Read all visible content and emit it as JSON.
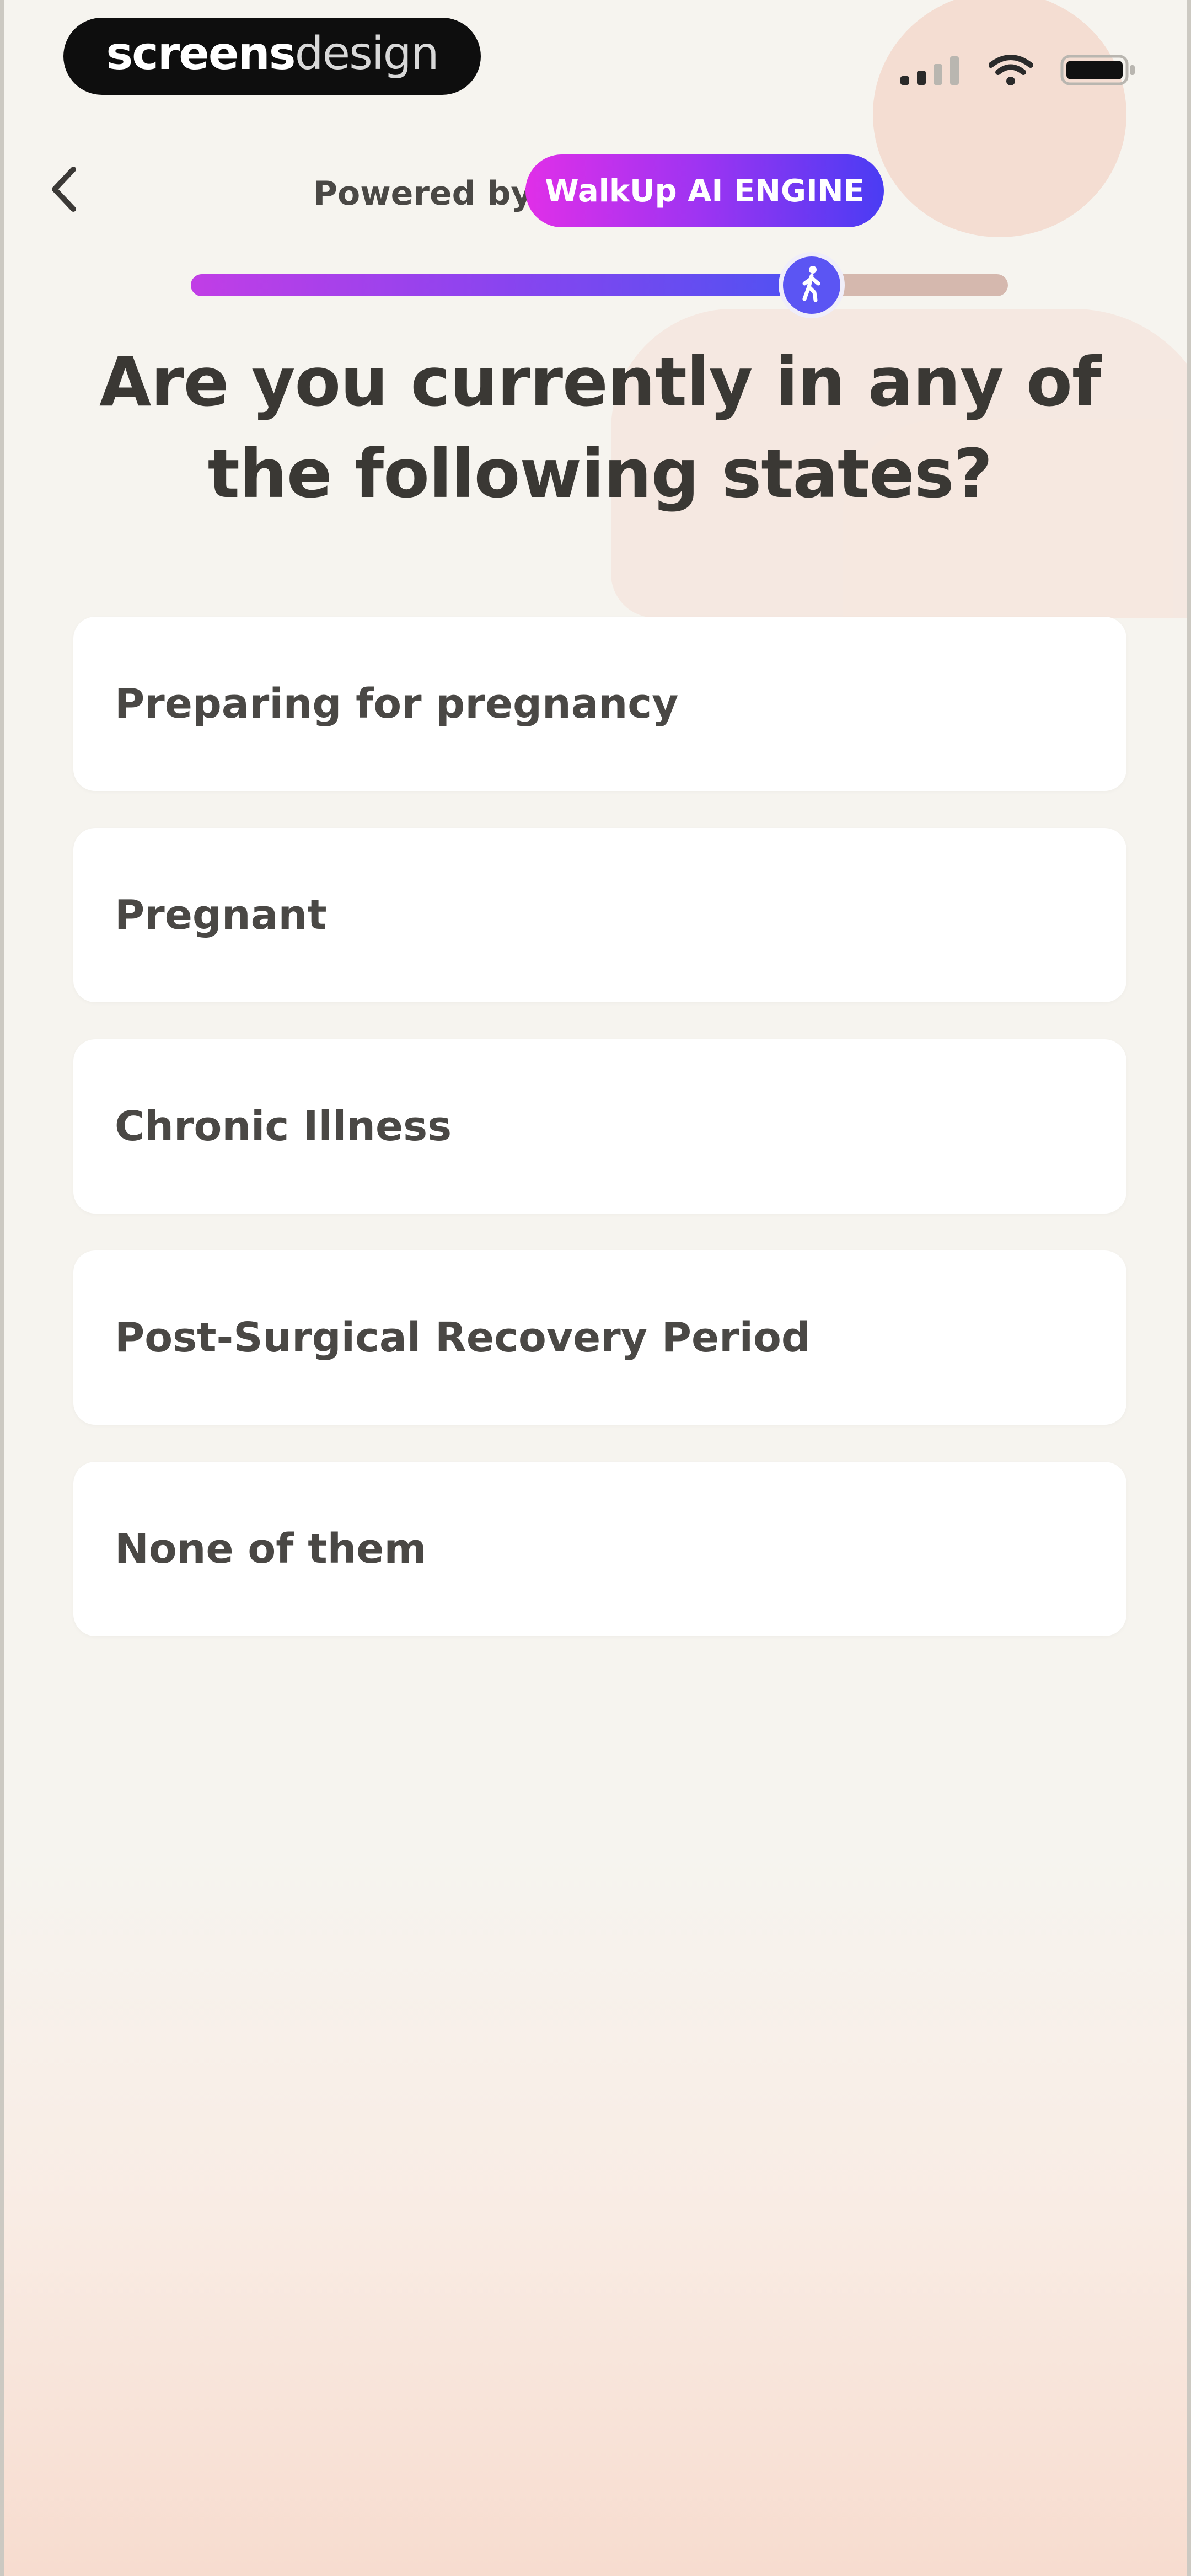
{
  "status_bar": {
    "brand_bold": "screens",
    "brand_light": "design",
    "icons": [
      "cellular-signal-icon",
      "wifi-icon",
      "battery-icon"
    ]
  },
  "nav": {
    "back_icon": "chevron-left-icon",
    "powered_label": "Powered by",
    "engine_badge": "WalkUp AI ENGINE"
  },
  "progress": {
    "value": 0.76,
    "thumb_icon": "walking-person-icon"
  },
  "question": "Are you currently in any of the following states?",
  "options": [
    "Preparing for pregnancy",
    "Pregnant",
    "Chronic Illness",
    "Post-Surgical Recovery Period",
    "None of them"
  ],
  "colors": {
    "accent_start": "#e02fe8",
    "accent_end": "#4a3cf3",
    "background": "#f6f4ef",
    "option_bg": "#ffffff"
  }
}
